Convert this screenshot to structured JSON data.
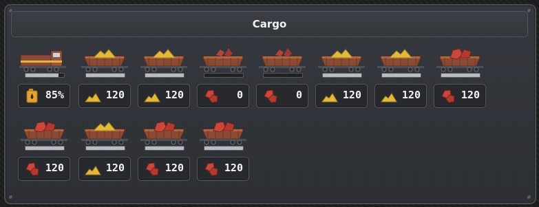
{
  "window": {
    "title": "Cargo"
  },
  "consist": [
    {
      "kind": "locomotive",
      "icon": "fuel-can-icon",
      "value": "85%",
      "fill": 0.85
    },
    {
      "kind": "hopper",
      "load": "coal",
      "icon": "coal-icon",
      "value": "120",
      "fill": 1.0
    },
    {
      "kind": "hopper",
      "load": "coal",
      "icon": "coal-icon",
      "value": "120",
      "fill": 1.0
    },
    {
      "kind": "hopper",
      "load": "iron-ore",
      "icon": "iron-ore-icon",
      "value": "0",
      "fill": 0.0
    },
    {
      "kind": "hopper",
      "load": "iron-ore",
      "icon": "iron-ore-icon",
      "value": "0",
      "fill": 0.0
    },
    {
      "kind": "hopper",
      "load": "coal",
      "icon": "coal-icon",
      "value": "120",
      "fill": 1.0
    },
    {
      "kind": "hopper",
      "load": "coal",
      "icon": "coal-icon",
      "value": "120",
      "fill": 1.0
    },
    {
      "kind": "hopper",
      "load": "iron-ore",
      "icon": "iron-ore-icon",
      "value": "120",
      "fill": 1.0
    },
    {
      "kind": "hopper",
      "load": "iron-ore",
      "icon": "iron-ore-icon",
      "value": "120",
      "fill": 1.0
    },
    {
      "kind": "hopper",
      "load": "coal",
      "icon": "coal-icon",
      "value": "120",
      "fill": 1.0
    },
    {
      "kind": "hopper",
      "load": "iron-ore",
      "icon": "iron-ore-icon",
      "value": "120",
      "fill": 1.0
    },
    {
      "kind": "hopper",
      "load": "iron-ore",
      "icon": "iron-ore-icon",
      "value": "120",
      "fill": 1.0
    }
  ],
  "colors": {
    "coal": "#e2b93b",
    "iron_ore": "#c9483b",
    "panel": "#2f3238",
    "text": "#f4f4f4"
  }
}
